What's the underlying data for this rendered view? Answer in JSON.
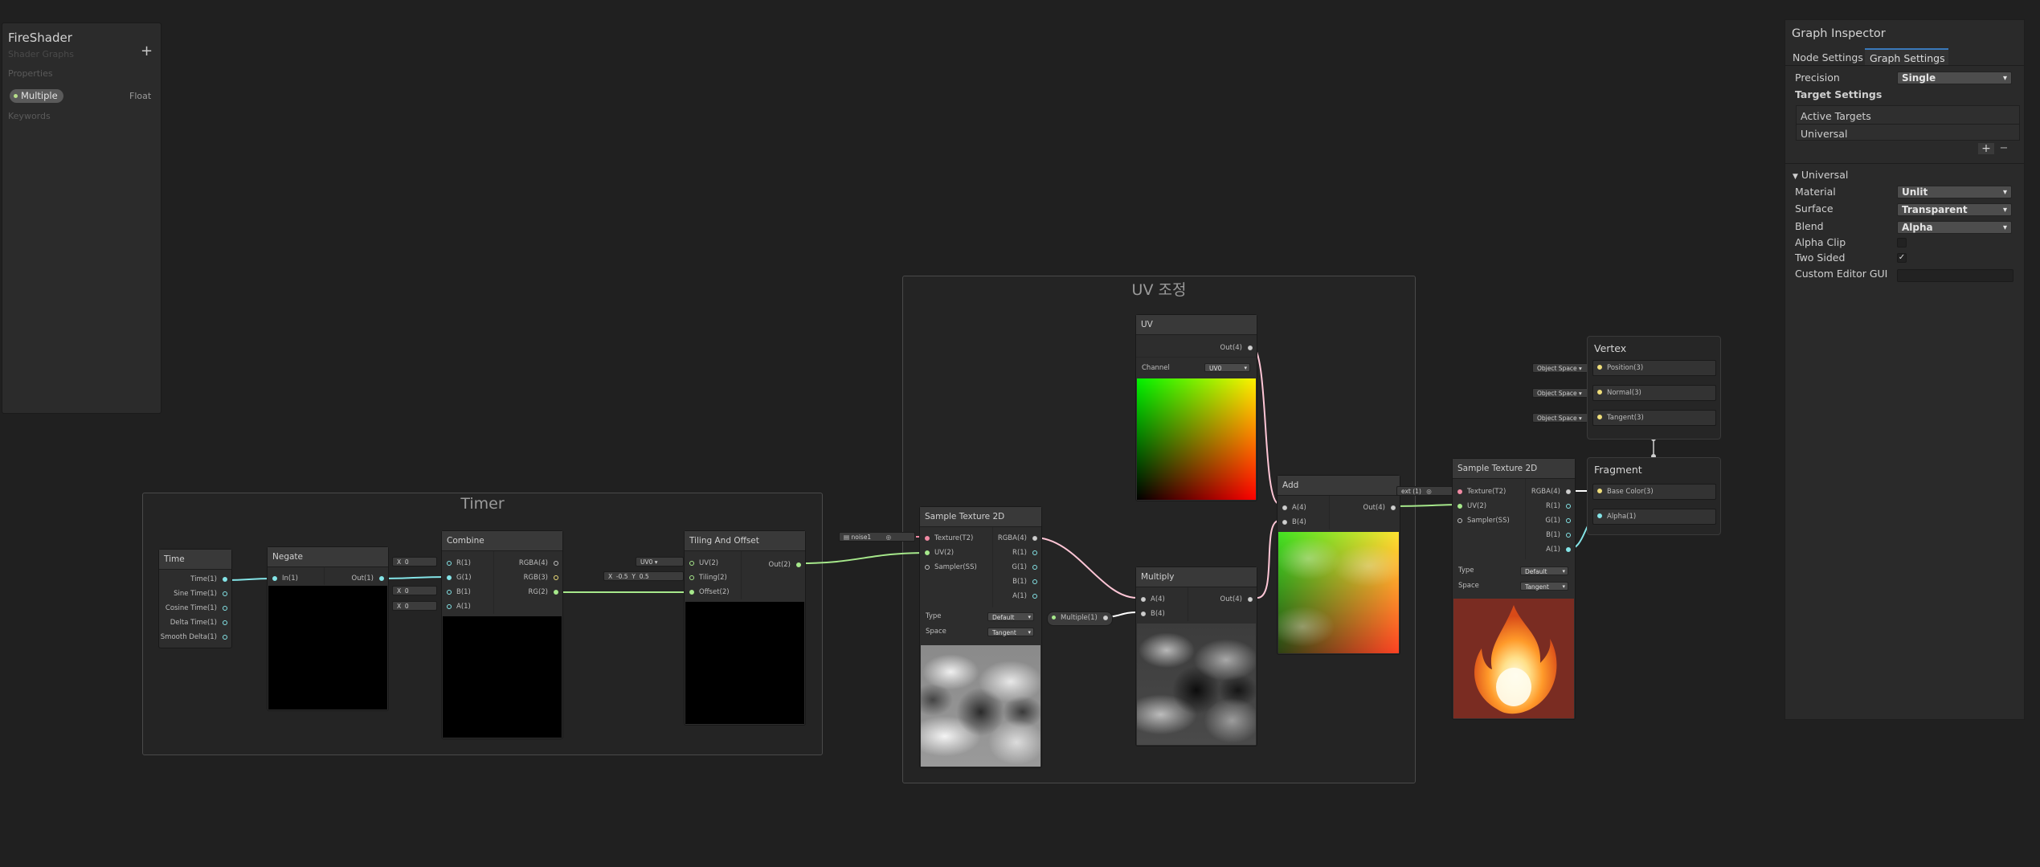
{
  "blackboard": {
    "title": "FireShader",
    "subtitle": "Shader Graphs",
    "add_label": "+",
    "properties_label": "Properties",
    "property": {
      "name": "Multiple",
      "type": "Float"
    },
    "keywords_label": "Keywords"
  },
  "groups": {
    "timer": "Timer",
    "uv": "UV 조정"
  },
  "nodes": {
    "time": {
      "title": "Time",
      "outputs": [
        "Time(1)",
        "Sine Time(1)",
        "Cosine Time(1)",
        "Delta Time(1)",
        "Smooth Delta(1)"
      ]
    },
    "negate": {
      "title": "Negate",
      "input": "In(1)",
      "output": "Out(1)"
    },
    "combine": {
      "title": "Combine",
      "inputs": [
        "R(1)",
        "G(1)",
        "B(1)",
        "A(1)"
      ],
      "outputs": [
        "RGBA(4)",
        "RGB(3)",
        "RG(2)"
      ],
      "field_x": "X",
      "field_value": "0"
    },
    "tiling": {
      "title": "Tiling And Offset",
      "inputs": [
        "UV(2)",
        "Tiling(2)",
        "Offset(2)"
      ],
      "output": "Out(2)",
      "uv_field": "UV0",
      "tiling_x_label": "X",
      "tiling_x": "-0.5",
      "tiling_y_label": "Y",
      "tiling_y": "0.5"
    },
    "sample1": {
      "title": "Sample Texture 2D",
      "inputs": [
        "Texture(T2)",
        "UV(2)",
        "Sampler(SS)"
      ],
      "outputs": [
        "RGBA(4)",
        "R(1)",
        "G(1)",
        "B(1)",
        "A(1)"
      ],
      "type_label": "Type",
      "type_value": "Default",
      "space_label": "Space",
      "space_value": "Tangent",
      "texture_field": "noise1"
    },
    "uv": {
      "title": "UV",
      "output": "Out(4)",
      "channel_label": "Channel",
      "channel_value": "UV0"
    },
    "multiply": {
      "title": "Multiply",
      "inputs": [
        "A(4)",
        "B(4)"
      ],
      "output": "Out(4)",
      "prop_pill": "Multiple(1)"
    },
    "add": {
      "title": "Add",
      "inputs": [
        "A(4)",
        "B(4)"
      ],
      "output": "Out(4)"
    },
    "sample2": {
      "title": "Sample Texture 2D",
      "inputs": [
        "Texture(T2)",
        "UV(2)",
        "Sampler(SS)"
      ],
      "outputs": [
        "RGBA(4)",
        "R(1)",
        "G(1)",
        "B(1)",
        "A(1)"
      ],
      "type_label": "Type",
      "type_value": "Default",
      "space_label": "Space",
      "space_value": "Tangent",
      "texture_field": "ext (1)"
    },
    "vertex": {
      "title": "Vertex",
      "ports": [
        "Position(3)",
        "Normal(3)",
        "Tangent(3)"
      ],
      "space_field": "Object Space"
    },
    "fragment": {
      "title": "Fragment",
      "ports": [
        "Base Color(3)",
        "Alpha(1)"
      ]
    }
  },
  "inspector": {
    "title": "Graph Inspector",
    "tabs": [
      "Node Settings",
      "Graph Settings"
    ],
    "precision_label": "Precision",
    "precision_value": "Single",
    "target_settings": "Target Settings",
    "active_targets": "Active Targets",
    "target_item": "Universal",
    "add_btn": "+",
    "remove_btn": "−",
    "universal_section": "Universal",
    "material_label": "Material",
    "material_value": "Unlit",
    "surface_label": "Surface",
    "surface_value": "Transparent",
    "blend_label": "Blend",
    "blend_value": "Alpha",
    "alpha_clip_label": "Alpha Clip",
    "alpha_clip": false,
    "two_sided_label": "Two Sided",
    "two_sided": true,
    "custom_editor_label": "Custom Editor GUI"
  }
}
